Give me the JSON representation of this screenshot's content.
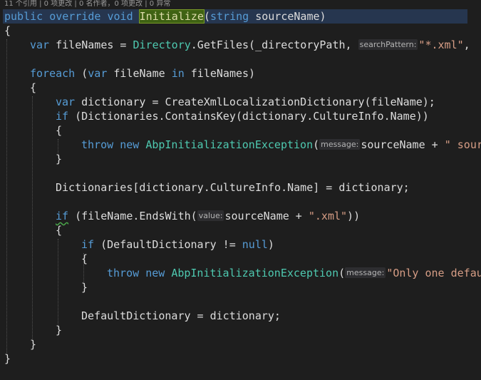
{
  "codelens": {
    "references": "11 个引用",
    "changes1": "0 项更改",
    "authors": "0 名作者，0 项更改",
    "exceptions": "0 异常"
  },
  "code": {
    "l1_public": "public",
    "l1_override": "override",
    "l1_void": "void",
    "l1_method": "Initialize",
    "l1_open": "(",
    "l1_string": "string",
    "l1_param": " sourceName)",
    "l2_brace": "{",
    "l3_var": "var",
    "l3_a": " fileNames = ",
    "l3_directory": "Directory",
    "l3_b": ".GetFiles(_directoryPath, ",
    "l3_hint": "searchPattern:",
    "l3_str": "\"*.xml\"",
    "l3_end": ",",
    "l5_foreach": "foreach",
    "l5_a": " (",
    "l5_var": "var",
    "l5_b": " fileName ",
    "l5_in": "in",
    "l5_c": " fileNames)",
    "l6_brace": "{",
    "l7_var": "var",
    "l7_rest": " dictionary = CreateXmlLocalizationDictionary(fileName);",
    "l8_if": "if",
    "l8_rest": " (Dictionaries.ContainsKey(dictionary.CultureInfo.Name))",
    "l9_brace": "{",
    "l10_throw": "throw",
    "l10_new": "new",
    "l10_type": "AbpInitializationException",
    "l10_open": "(",
    "l10_hint": "message:",
    "l10_a": "sourceName + ",
    "l10_str": "\" sour",
    "l11_brace": "}",
    "l13_text": "Dictionaries[dictionary.CultureInfo.Name] = dictionary;",
    "l15_if": "if",
    "l15_a": " (fileName.EndsWith(",
    "l15_hint": "value:",
    "l15_b": "sourceName + ",
    "l15_str": "\".xml\"",
    "l15_end": "))",
    "l16_brace": "{",
    "l17_if": "if",
    "l17_a": " (DefaultDictionary != ",
    "l17_null": "null",
    "l17_end": ")",
    "l18_brace": "{",
    "l19_throw": "throw",
    "l19_new": "new",
    "l19_type": "AbpInitializationException",
    "l19_open": "(",
    "l19_hint": "message:",
    "l19_str": "\"Only one defau",
    "l20_brace": "}",
    "l22_text": "DefaultDictionary = dictionary;",
    "l23_brace": "}",
    "l24_brace": "}",
    "l25_brace": "}"
  }
}
